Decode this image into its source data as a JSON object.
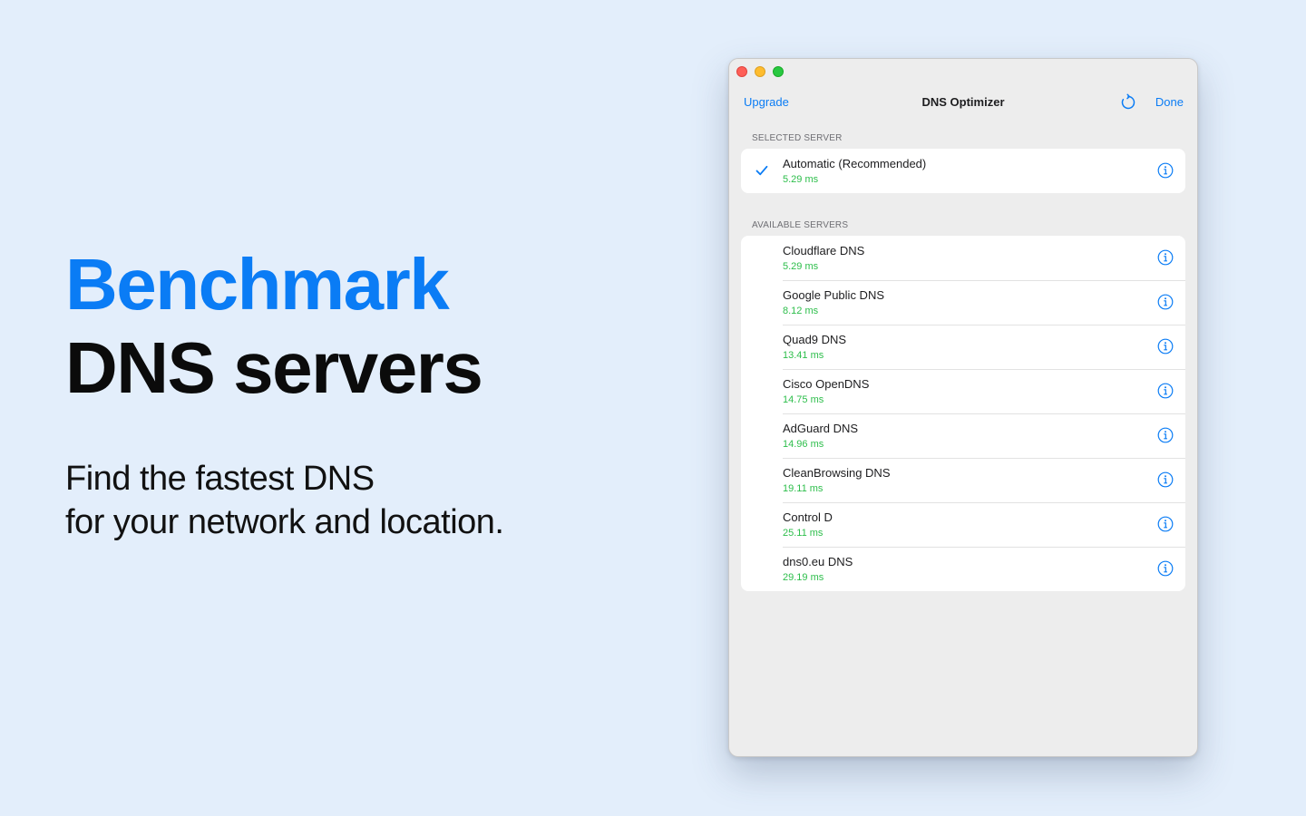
{
  "hero": {
    "title_line1": "Benchmark",
    "title_line2": "DNS servers",
    "subtitle_line1": "Find the fastest DNS",
    "subtitle_line2": "for your network and location."
  },
  "window": {
    "title": "DNS Optimizer",
    "upgrade_label": "Upgrade",
    "done_label": "Done",
    "refresh_icon": "refresh-icon"
  },
  "selected_section": {
    "header": "SELECTED SERVER",
    "server": {
      "name": "Automatic (Recommended)",
      "latency": "5.29 ms",
      "selected": true
    }
  },
  "available_section": {
    "header": "AVAILABLE SERVERS",
    "servers": [
      {
        "name": "Cloudflare DNS",
        "latency": "5.29 ms"
      },
      {
        "name": "Google Public DNS",
        "latency": "8.12 ms"
      },
      {
        "name": "Quad9 DNS",
        "latency": "13.41 ms"
      },
      {
        "name": "Cisco OpenDNS",
        "latency": "14.75 ms"
      },
      {
        "name": "AdGuard DNS",
        "latency": "14.96 ms"
      },
      {
        "name": "CleanBrowsing DNS",
        "latency": "19.11 ms"
      },
      {
        "name": "Control D",
        "latency": "25.11 ms"
      },
      {
        "name": "dns0.eu DNS",
        "latency": "29.19 ms"
      }
    ]
  },
  "colors": {
    "accent": "#0A7CF5",
    "latency": "#2DBE4B",
    "background": "#E3EEFB"
  }
}
